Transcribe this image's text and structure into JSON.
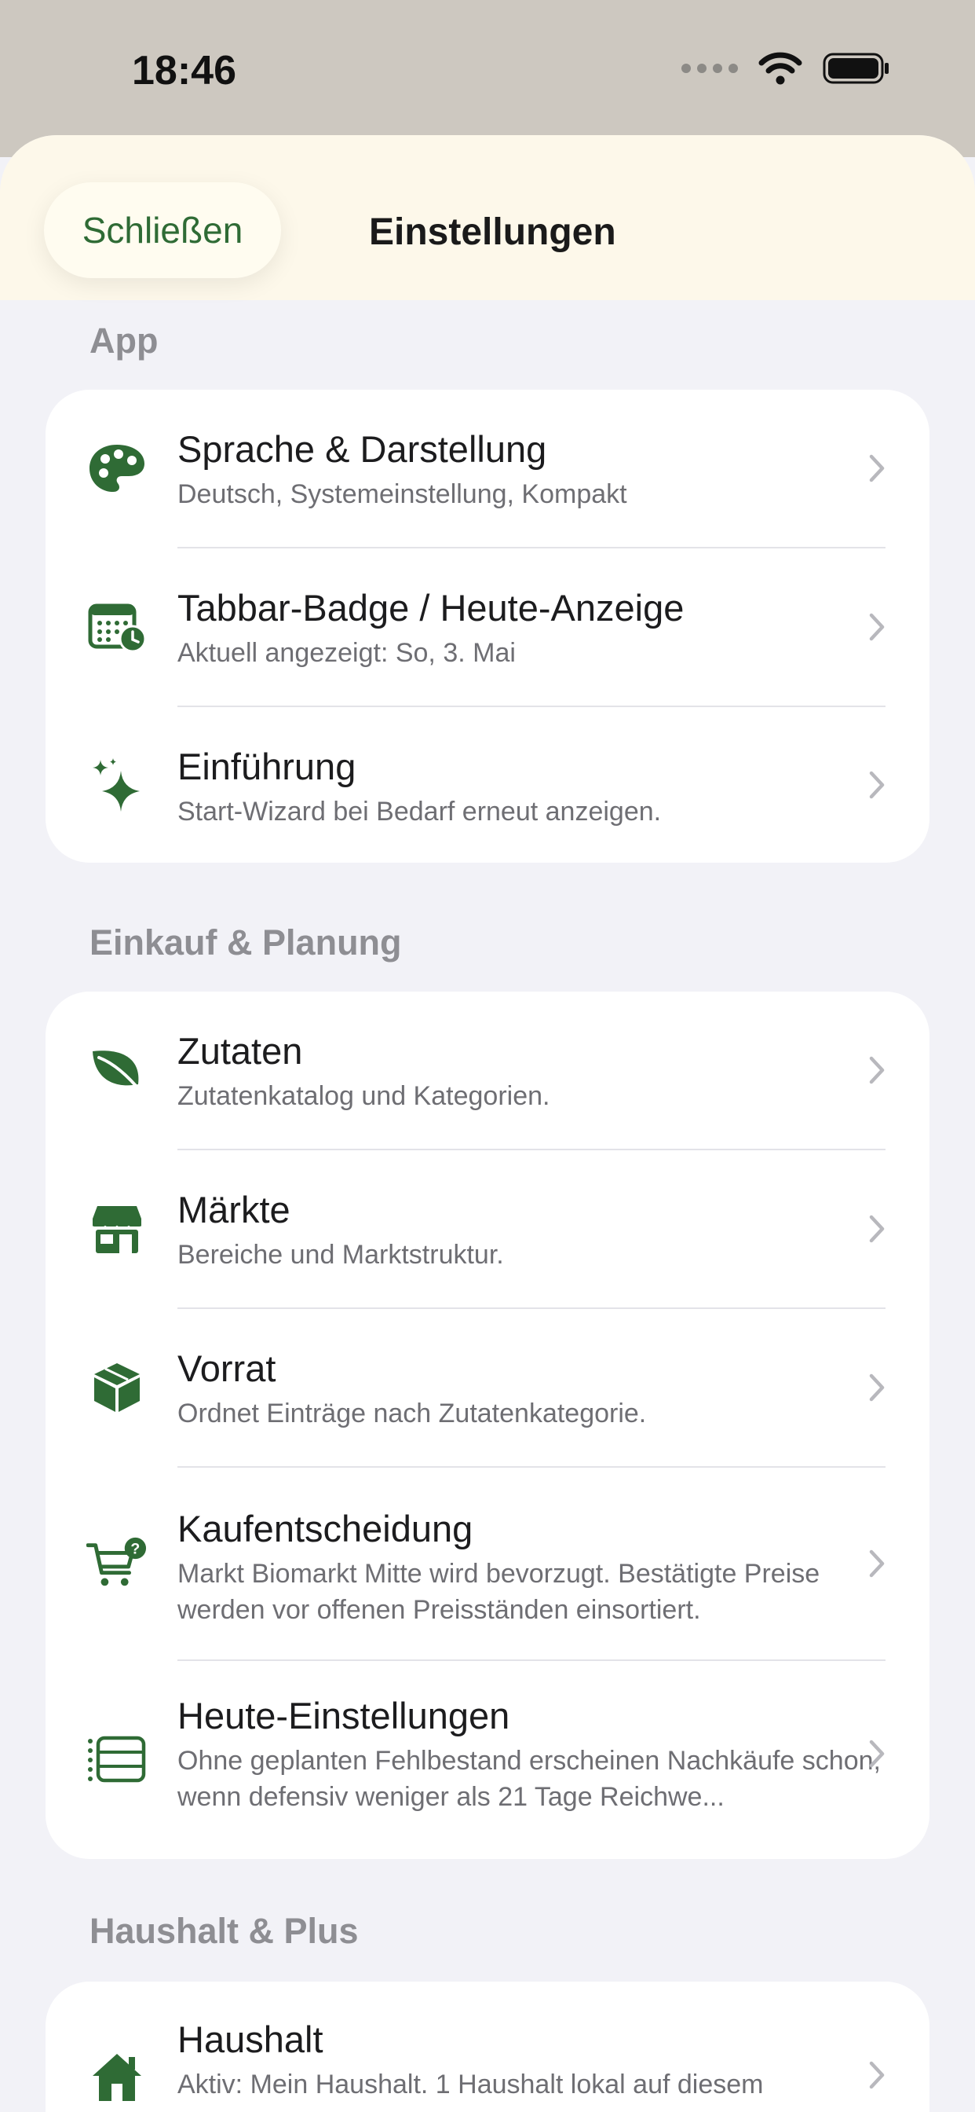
{
  "status_bar": {
    "time": "18:46"
  },
  "header": {
    "close_label": "Schließen",
    "title": "Einstellungen"
  },
  "sections": [
    {
      "title": "App",
      "items": [
        {
          "icon": "palette-icon",
          "title": "Sprache & Darstellung",
          "subtitle": "Deutsch, Systemeinstellung, Kompakt"
        },
        {
          "icon": "calendar-clock-icon",
          "title": "Tabbar-Badge / Heute-Anzeige",
          "subtitle": "Aktuell angezeigt: So, 3. Mai"
        },
        {
          "icon": "sparkles-icon",
          "title": "Einführung",
          "subtitle": "Start-Wizard bei Bedarf erneut anzeigen."
        }
      ]
    },
    {
      "title": "Einkauf & Planung",
      "items": [
        {
          "icon": "leaf-icon",
          "title": "Zutaten",
          "subtitle": "Zutatenkatalog und Kategorien."
        },
        {
          "icon": "storefront-icon",
          "title": "Märkte",
          "subtitle": "Bereiche und Marktstruktur."
        },
        {
          "icon": "box-icon",
          "title": "Vorrat",
          "subtitle": "Ordnet Einträge nach Zutatenkategorie."
        },
        {
          "icon": "cart-question-icon",
          "title": "Kaufentscheidung",
          "subtitle": "Markt Biomarkt Mitte wird bevorzugt. Bestätigte Preise werden vor offenen Preisständen einsortiert."
        },
        {
          "icon": "list-rectangle-icon",
          "title": "Heute-Einstellungen",
          "subtitle": "Ohne geplanten Fehlbestand erscheinen Nachkäufe schon, wenn defensiv weniger als 21 Tage Reichwe..."
        }
      ]
    },
    {
      "title": "Haushalt & Plus",
      "items": [
        {
          "icon": "house-icon",
          "title": "Haushalt",
          "subtitle": "Aktiv: Mein Haushalt. 1 Haushalt lokal auf diesem"
        }
      ]
    }
  ],
  "colors": {
    "accent": "#2f6b35",
    "background": "#f2f2f7",
    "header_bg": "#fdf8ea"
  }
}
